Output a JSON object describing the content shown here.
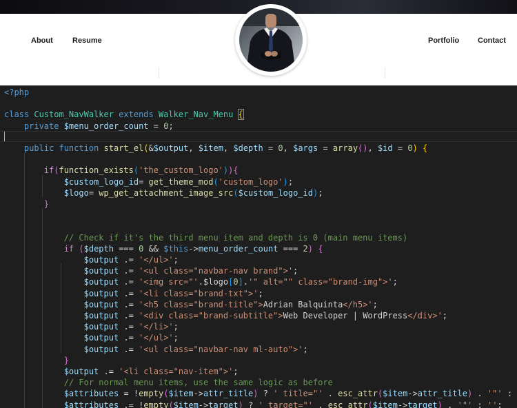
{
  "nav": {
    "links_left": [
      "About",
      "Resume"
    ],
    "links_right": [
      "Portfolio",
      "Contact"
    ]
  },
  "avatar": {
    "alt": "profile-photo"
  },
  "editor": {
    "lines": [
      [
        [
          "kw",
          "<?php"
        ]
      ],
      [],
      [
        [
          "kw",
          "class "
        ],
        [
          "cls",
          "Custom_NavWalker "
        ],
        [
          "kw",
          "extends "
        ],
        [
          "cls",
          "Walker_Nav_Menu "
        ],
        [
          "bkhl",
          "{"
        ]
      ],
      [
        [
          "",
          "    "
        ],
        [
          "kw",
          "private "
        ],
        [
          "var",
          "$menu_order_count"
        ],
        [
          "",
          " = "
        ],
        [
          "num",
          "0"
        ],
        [
          "",
          ";"
        ]
      ],
      [],
      [
        [
          "",
          "    "
        ],
        [
          "kw",
          "public function "
        ],
        [
          "fn",
          "start_el"
        ],
        [
          "bk1",
          "("
        ],
        [
          "",
          "&"
        ],
        [
          "var",
          "$output"
        ],
        [
          "",
          ", "
        ],
        [
          "var",
          "$item"
        ],
        [
          "",
          ", "
        ],
        [
          "var",
          "$depth"
        ],
        [
          "",
          " = "
        ],
        [
          "num",
          "0"
        ],
        [
          "",
          ", "
        ],
        [
          "var",
          "$args"
        ],
        [
          "",
          " = "
        ],
        [
          "fn",
          "array"
        ],
        [
          "bk2",
          "()"
        ],
        [
          "",
          ", "
        ],
        [
          "var",
          "$id"
        ],
        [
          "",
          " = "
        ],
        [
          "num",
          "0"
        ],
        [
          "bk1",
          ")"
        ],
        [
          "",
          " "
        ],
        [
          "bk1",
          "{"
        ]
      ],
      [],
      [
        [
          "",
          "        "
        ],
        [
          "ctl",
          "if"
        ],
        [
          "bk2",
          "("
        ],
        [
          "fn",
          "function_exists"
        ],
        [
          "bk3",
          "("
        ],
        [
          "str",
          "'the_custom_logo'"
        ],
        [
          "bk3",
          ")"
        ],
        [
          "bk2",
          ")"
        ],
        [
          "bk2",
          "{"
        ]
      ],
      [
        [
          "",
          "            "
        ],
        [
          "var",
          "$custom_logo_id"
        ],
        [
          "",
          "= "
        ],
        [
          "fn",
          "get_theme_mod"
        ],
        [
          "bk3",
          "("
        ],
        [
          "str",
          "'custom_logo'"
        ],
        [
          "bk3",
          ")"
        ],
        [
          "",
          ";"
        ]
      ],
      [
        [
          "",
          "            "
        ],
        [
          "var",
          "$logo"
        ],
        [
          "",
          "= "
        ],
        [
          "fn",
          "wp_get_attachment_image_src"
        ],
        [
          "bk3",
          "("
        ],
        [
          "var",
          "$custom_logo_id"
        ],
        [
          "bk3",
          ")"
        ],
        [
          "",
          ";"
        ]
      ],
      [
        [
          "",
          "        "
        ],
        [
          "bk2",
          "}"
        ]
      ],
      [],
      [],
      [
        [
          "",
          "            "
        ],
        [
          "cmt",
          "// Check if it's the third menu item and depth is 0 (main menu items)"
        ]
      ],
      [
        [
          "",
          "            "
        ],
        [
          "ctl",
          "if "
        ],
        [
          "bk2",
          "("
        ],
        [
          "var",
          "$depth"
        ],
        [
          "",
          " === "
        ],
        [
          "num",
          "0"
        ],
        [
          "",
          " && "
        ],
        [
          "kw",
          "$this"
        ],
        [
          "",
          "->"
        ],
        [
          "var",
          "menu_order_count"
        ],
        [
          "",
          " === "
        ],
        [
          "num",
          "2"
        ],
        [
          "bk2",
          ")"
        ],
        [
          "",
          " "
        ],
        [
          "bk2",
          "{"
        ]
      ],
      [
        [
          "",
          "                "
        ],
        [
          "var",
          "$output"
        ],
        [
          "",
          " .= "
        ],
        [
          "str",
          "'</ul>'"
        ],
        [
          "",
          ";"
        ]
      ],
      [
        [
          "",
          "                "
        ],
        [
          "var",
          "$output"
        ],
        [
          "",
          " .= "
        ],
        [
          "str",
          "'<ul class=\"navbar-nav brand\">'"
        ],
        [
          "",
          ";"
        ]
      ],
      [
        [
          "",
          "                "
        ],
        [
          "var",
          "$output"
        ],
        [
          "",
          " .= "
        ],
        [
          "str",
          "'<img src=\"'"
        ],
        [
          "",
          ".$logo"
        ],
        [
          "bk3",
          "["
        ],
        [
          "num",
          "0"
        ],
        [
          "bk3",
          "]"
        ],
        [
          "",
          "."
        ],
        [
          "str",
          "'\" alt=\"\" class=\"brand-img\">'"
        ],
        [
          "",
          ";"
        ]
      ],
      [
        [
          "",
          "                "
        ],
        [
          "var",
          "$output"
        ],
        [
          "",
          " .= "
        ],
        [
          "str",
          "'<li class=\"brand-txt\">'"
        ],
        [
          "",
          ";"
        ]
      ],
      [
        [
          "",
          "                "
        ],
        [
          "var",
          "$output"
        ],
        [
          "",
          " .= "
        ],
        [
          "str",
          "'<h5 class=\"brand-title\">"
        ],
        [
          "",
          "Adrian Balquinta"
        ],
        [
          "str",
          "</h5>'"
        ],
        [
          "",
          ";"
        ]
      ],
      [
        [
          "",
          "                "
        ],
        [
          "var",
          "$output"
        ],
        [
          "",
          " .= "
        ],
        [
          "str",
          "'<div class=\"brand-subtitle\">"
        ],
        [
          "",
          "Web Developer | WordPress"
        ],
        [
          "str",
          "</div>'"
        ],
        [
          "",
          ";"
        ]
      ],
      [
        [
          "",
          "                "
        ],
        [
          "var",
          "$output"
        ],
        [
          "",
          " .= "
        ],
        [
          "str",
          "'</li>'"
        ],
        [
          "",
          ";"
        ]
      ],
      [
        [
          "",
          "                "
        ],
        [
          "var",
          "$output"
        ],
        [
          "",
          " .= "
        ],
        [
          "str",
          "'</ul>'"
        ],
        [
          "",
          ";"
        ]
      ],
      [
        [
          "",
          "                "
        ],
        [
          "var",
          "$output"
        ],
        [
          "",
          " .= "
        ],
        [
          "str",
          "'<ul class=\"navbar-nav ml-auto\">'"
        ],
        [
          "",
          ";"
        ]
      ],
      [
        [
          "",
          "            "
        ],
        [
          "bk2",
          "}"
        ]
      ],
      [
        [
          "",
          "            "
        ],
        [
          "var",
          "$output"
        ],
        [
          "",
          " .= "
        ],
        [
          "str",
          "'<li class=\"nav-item\">'"
        ],
        [
          "",
          ";"
        ]
      ],
      [
        [
          "",
          "            "
        ],
        [
          "cmt",
          "// For normal menu items, use the same logic as before"
        ]
      ],
      [
        [
          "",
          "            "
        ],
        [
          "var",
          "$attributes"
        ],
        [
          "",
          " = !"
        ],
        [
          "fn",
          "empty"
        ],
        [
          "bk2",
          "("
        ],
        [
          "var",
          "$item"
        ],
        [
          "",
          "->"
        ],
        [
          "var",
          "attr_title"
        ],
        [
          "bk2",
          ")"
        ],
        [
          "",
          " ? "
        ],
        [
          "str",
          "' title=\"'"
        ],
        [
          "",
          " . "
        ],
        [
          "fn",
          "esc_attr"
        ],
        [
          "bk2",
          "("
        ],
        [
          "var",
          "$item"
        ],
        [
          "",
          "->"
        ],
        [
          "var",
          "attr_title"
        ],
        [
          "bk2",
          ")"
        ],
        [
          "",
          " . "
        ],
        [
          "str",
          "'\"'"
        ],
        [
          "",
          " : "
        ],
        [
          "str",
          "''"
        ],
        [
          "",
          ";"
        ]
      ],
      [
        [
          "",
          "            "
        ],
        [
          "var",
          "$attributes"
        ],
        [
          "",
          " .= !"
        ],
        [
          "fn",
          "empty"
        ],
        [
          "bk2",
          "("
        ],
        [
          "var",
          "$item"
        ],
        [
          "",
          "->"
        ],
        [
          "var",
          "target"
        ],
        [
          "bk2",
          ")"
        ],
        [
          "",
          " ? "
        ],
        [
          "str",
          "' target=\"'"
        ],
        [
          "",
          " . "
        ],
        [
          "fn",
          "esc_attr"
        ],
        [
          "bk2",
          "("
        ],
        [
          "var",
          "$item"
        ],
        [
          "",
          "->"
        ],
        [
          "var",
          "target"
        ],
        [
          "bk2",
          ")"
        ],
        [
          "",
          " . "
        ],
        [
          "str",
          "'\"'"
        ],
        [
          "",
          " : "
        ],
        [
          "str",
          "''"
        ],
        [
          "",
          ";"
        ]
      ]
    ]
  }
}
